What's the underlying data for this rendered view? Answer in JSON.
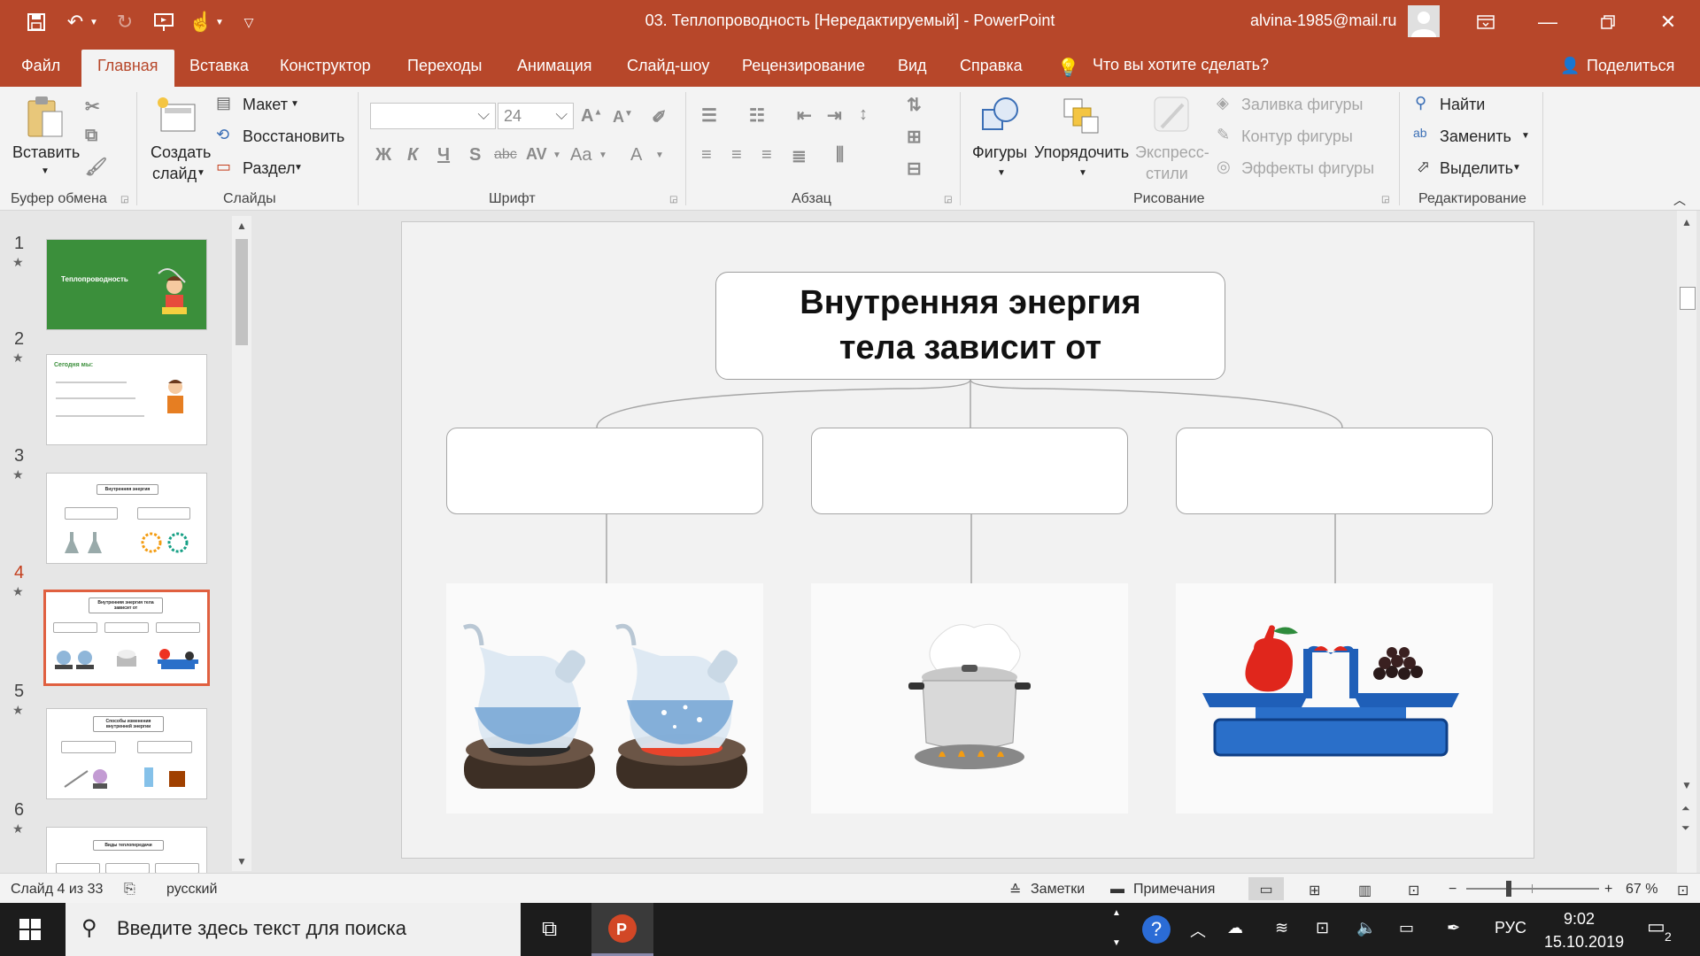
{
  "titlebar": {
    "document_title": "03. Теплопроводность [Нередактируемый]  -  PowerPoint",
    "user_email": "alvina-1985@mail.ru"
  },
  "tabs": [
    {
      "label": "Файл",
      "active": false
    },
    {
      "label": "Главная",
      "active": true
    },
    {
      "label": "Вставка",
      "active": false
    },
    {
      "label": "Конструктор",
      "active": false
    },
    {
      "label": "Переходы",
      "active": false
    },
    {
      "label": "Анимация",
      "active": false
    },
    {
      "label": "Слайд-шоу",
      "active": false
    },
    {
      "label": "Рецензирование",
      "active": false
    },
    {
      "label": "Вид",
      "active": false
    },
    {
      "label": "Справка",
      "active": false
    }
  ],
  "tell_me": "Что вы хотите сделать?",
  "share": "Поделиться",
  "ribbon": {
    "clipboard": {
      "paste": "Вставить",
      "group_label": "Буфер обмена"
    },
    "slides": {
      "new_slide_line1": "Создать",
      "new_slide_line2": "слайд",
      "layout": "Макет",
      "reset": "Восстановить",
      "section": "Раздел",
      "group_label": "Слайды"
    },
    "font": {
      "font_size": "24",
      "bold": "Ж",
      "italic": "К",
      "underline": "Ч",
      "shadow": "S",
      "strike": "abc",
      "spacing": "AV",
      "case": "Aa",
      "color": "A",
      "group_label": "Шрифт"
    },
    "paragraph": {
      "group_label": "Абзац"
    },
    "drawing": {
      "shapes": "Фигуры",
      "arrange": "Упорядочить",
      "quick_styles_line1": "Экспресс-",
      "quick_styles_line2": "стили",
      "fill": "Заливка фигуры",
      "outline": "Контур фигуры",
      "effects": "Эффекты фигуры",
      "group_label": "Рисование"
    },
    "editing": {
      "find": "Найти",
      "replace": "Заменить",
      "select": "Выделить",
      "group_label": "Редактирование"
    }
  },
  "thumbnails": [
    {
      "number": "1",
      "title": "Теплопроводность",
      "selected": false
    },
    {
      "number": "2",
      "title": "Сегодня мы:",
      "selected": false
    },
    {
      "number": "3",
      "title": "Внутренняя энергия",
      "selected": false
    },
    {
      "number": "4",
      "title": "Внутренняя энергия тела зависит от",
      "selected": true
    },
    {
      "number": "5",
      "title": "Способы изменения внутренней энергии",
      "selected": false
    },
    {
      "number": "6",
      "title": "Виды теплопередачи",
      "selected": false
    }
  ],
  "slide": {
    "title": "Внутренняя энергия тела зависит от"
  },
  "statusbar": {
    "slide_info": "Слайд 4 из 33",
    "language": "русский",
    "notes": "Заметки",
    "comments": "Примечания",
    "zoom": "67 %",
    "zoom_level": 0.67
  },
  "taskbar": {
    "search_placeholder": "Введите здесь текст для поиска",
    "input_lang": "РУС",
    "time": "9:02",
    "date": "15.10.2019",
    "notifications": "2"
  },
  "colors": {
    "accent": "#b7472a",
    "ribbon_bg": "#f3f3f3",
    "selected_thumb": "#e06040"
  }
}
